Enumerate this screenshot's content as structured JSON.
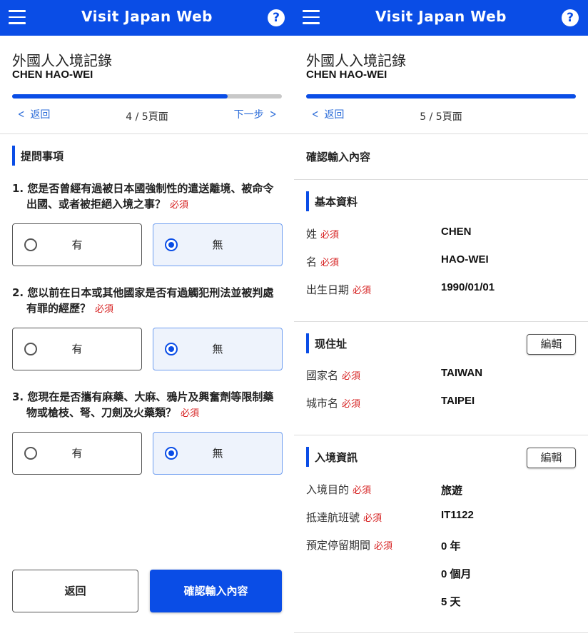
{
  "app": {
    "title": "Visit Japan Web",
    "help_symbol": "?",
    "menu_icon": "hamburger-menu-icon",
    "accent_color": "#0a4de6",
    "required_color": "#d62020"
  },
  "left": {
    "page_title": "外國人入境記錄",
    "name": "CHEN HAO-WEI",
    "progress": 0.8,
    "back_label": "返回",
    "next_label": "下一步",
    "page_indicator": "4 / 5頁面",
    "section_title": "提問事項",
    "required_label": "必須",
    "questions": [
      {
        "number": "1.",
        "text": "您是否曾經有過被日本國強制性的遣送離境、被命令出國、或者被拒絕入境之事？",
        "options": [
          "有",
          "無"
        ],
        "selected": "無"
      },
      {
        "number": "2.",
        "text": "您以前在日本或其他國家是否有過觸犯刑法並被判處有罪的經歷？",
        "options": [
          "有",
          "無"
        ],
        "selected": "無"
      },
      {
        "number": "3.",
        "text": "您現在是否攜有麻藥、大麻、鴉片及興奮劑等限制藥物或槍枝、弩、刀劍及火藥類？",
        "options": [
          "有",
          "無"
        ],
        "selected": "無"
      }
    ],
    "footer": {
      "back_button": "返回",
      "confirm_button": "確認輸入內容"
    }
  },
  "right": {
    "page_title": "外國人入境記錄",
    "name": "CHEN HAO-WEI",
    "progress": 1.0,
    "back_label": "返回",
    "page_indicator": "5 / 5頁面",
    "confirm_heading": "確認輸入內容",
    "required_label": "必須",
    "edit_label": "編輯",
    "basic": {
      "title": "基本資料",
      "rows": [
        {
          "label": "姓",
          "value": "CHEN"
        },
        {
          "label": "名",
          "value": "HAO-WEI"
        },
        {
          "label": "出生日期",
          "value": "1990/01/01"
        }
      ]
    },
    "address": {
      "title": "现住址",
      "rows": [
        {
          "label": "國家名",
          "value": "TAIWAN"
        },
        {
          "label": "城市名",
          "value": "TAIPEI"
        }
      ]
    },
    "entry": {
      "title": "入境資訊",
      "rows": [
        {
          "label": "入境目的",
          "value": "旅遊"
        },
        {
          "label": "抵達航班號",
          "value": "IT1122"
        },
        {
          "label": "預定停留期間",
          "value": "0 年"
        }
      ],
      "stay_months": "0 個月",
      "stay_days": "5 天"
    }
  }
}
